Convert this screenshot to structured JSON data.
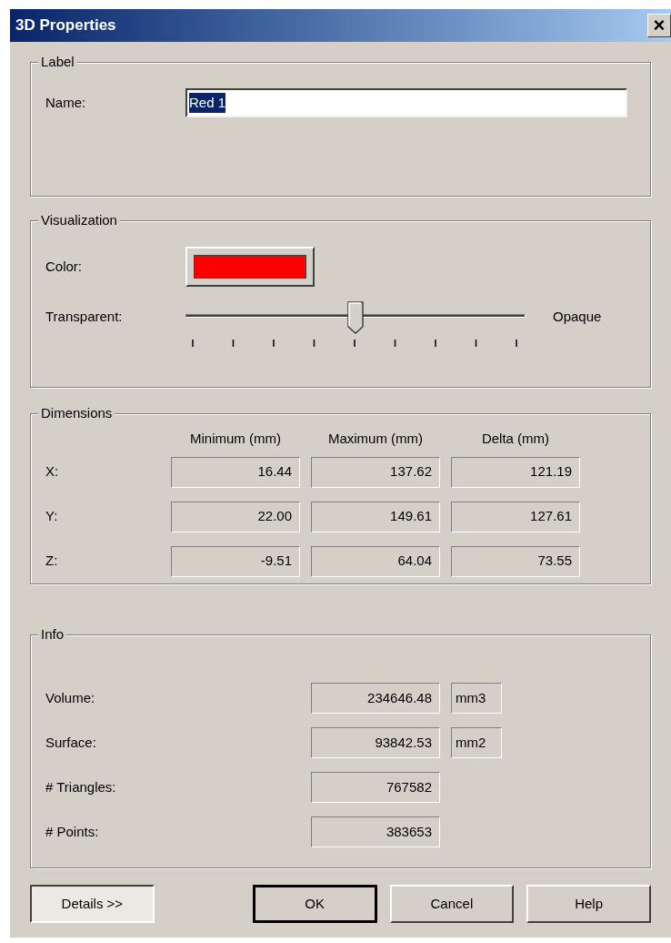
{
  "window": {
    "title": "3D Properties",
    "close": "×"
  },
  "label_group": {
    "title": "Label",
    "name_label": "Name:",
    "name_value": "Red 1",
    "text_selected": true
  },
  "visualization": {
    "title": "Visualization",
    "color_label": "Color:",
    "color": "#ff0000",
    "transparency_label": "Transparent:",
    "opacity": {
      "level": 0.5,
      "end_label": "Opaque"
    }
  },
  "dimensions": {
    "title": "Dimensions",
    "columns": [
      "Minimum (mm)",
      "Maximum (mm)",
      "Delta (mm)"
    ],
    "rows": [
      {
        "label": "X:",
        "values": [
          "16.44",
          "137.62",
          "121.19"
        ]
      },
      {
        "label": "Y:",
        "values": [
          "22.00",
          "149.61",
          "127.61"
        ]
      },
      {
        "label": "Z:",
        "values": [
          "-9.51",
          "64.04",
          "73.55"
        ]
      }
    ]
  },
  "info": {
    "title": "Info",
    "rows": [
      {
        "label": "Volume:",
        "value": "234646.48",
        "unit": "mm3"
      },
      {
        "label": "Surface:",
        "value": "93842.53",
        "unit": "mm2"
      },
      {
        "label": "# Triangles:",
        "value": "767582"
      },
      {
        "label": "# Points:",
        "value": "383653"
      }
    ]
  },
  "buttons": [
    {
      "label": "Details >>",
      "default": false,
      "pressed": true
    },
    {
      "label": "OK",
      "default": true,
      "pressed": false
    },
    {
      "label": "Cancel",
      "default": false,
      "pressed": false
    },
    {
      "label": "Help",
      "default": false,
      "pressed": false
    }
  ]
}
